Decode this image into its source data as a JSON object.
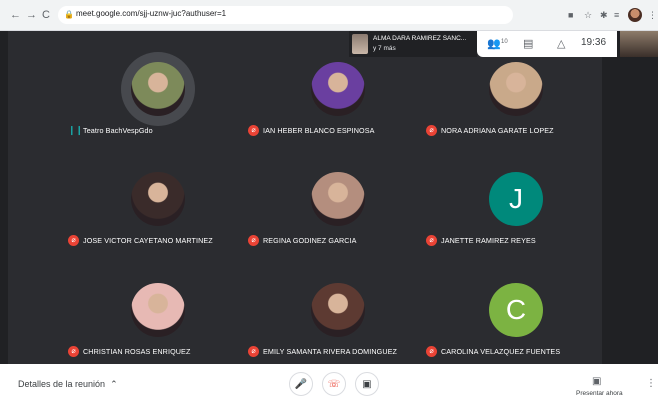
{
  "browser": {
    "back": "←",
    "forward": "→",
    "reload": "C",
    "url": "meet.google.com/sjj-uznw-juc?authuser=1"
  },
  "presenter": {
    "name": "ALMA DARA RAMIREZ SANC...",
    "sub": "y 7 más"
  },
  "topbar": {
    "people_count": "10",
    "time": "19:36"
  },
  "participants": [
    {
      "name": "Teatro BachVespGdo",
      "muted": false,
      "speaking": true,
      "avatar": "photo",
      "color": "#7d8a5a"
    },
    {
      "name": "IAN HEBER BLANCO ESPINOSA",
      "muted": true,
      "avatar": "photo",
      "color": "#6a3fa0"
    },
    {
      "name": "NORA ADRIANA GARATE LOPEZ",
      "muted": true,
      "avatar": "photo",
      "color": "#c9a98a"
    },
    {
      "name": "JOSE VICTOR CAYETANO MARTINEZ",
      "muted": true,
      "avatar": "photo",
      "color": "#3a2b2a"
    },
    {
      "name": "REGINA GODINEZ GARCIA",
      "muted": true,
      "avatar": "photo",
      "color": "#b48e7e"
    },
    {
      "name": "JANETTE RAMIREZ REYES",
      "muted": true,
      "avatar": "letter",
      "letter": "J",
      "color": "#00897b"
    },
    {
      "name": "CHRISTIAN ROSAS ENRIQUEZ",
      "muted": true,
      "avatar": "photo",
      "color": "#e7b9b4"
    },
    {
      "name": "EMILY SAMANTA RIVERA DOMINGUEZ",
      "muted": true,
      "avatar": "photo",
      "color": "#5d3a32"
    },
    {
      "name": "CAROLINA VELAZQUEZ FUENTES",
      "muted": true,
      "avatar": "letter",
      "letter": "C",
      "color": "#7cb342"
    }
  ],
  "bottom": {
    "details": "Detalles de la reunión",
    "present": "Presentar ahora"
  }
}
